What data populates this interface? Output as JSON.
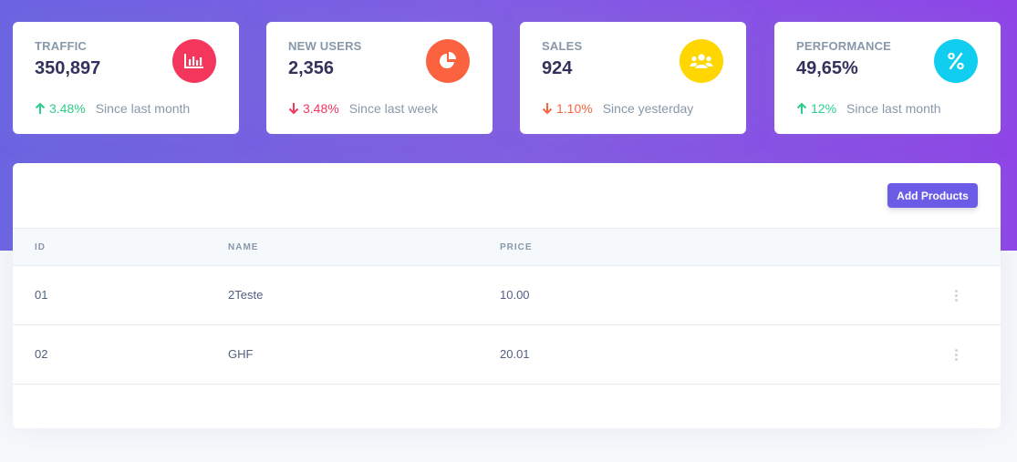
{
  "stats": [
    {
      "title": "TRAFFIC",
      "value": "350,897",
      "icon": "bar-chart-icon",
      "icon_color": "#f5365c",
      "change": "3.48%",
      "direction": "up",
      "change_color": "#2dce89",
      "since": "Since last month"
    },
    {
      "title": "NEW USERS",
      "value": "2,356",
      "icon": "pie-chart-icon",
      "icon_color": "#fb6340",
      "change": "3.48%",
      "direction": "down",
      "change_color": "#f5365c",
      "since": "Since last week"
    },
    {
      "title": "SALES",
      "value": "924",
      "icon": "users-icon",
      "icon_color": "#ffd600",
      "change": "1.10%",
      "direction": "down",
      "change_color": "#fb6340",
      "since": "Since yesterday"
    },
    {
      "title": "PERFORMANCE",
      "value": "49,65%",
      "icon": "percent-icon",
      "icon_color": "#11cdef",
      "change": "12%",
      "direction": "up",
      "change_color": "#2dce89",
      "since": "Since last month"
    }
  ],
  "products": {
    "add_button_label": "Add Products",
    "columns": [
      "ID",
      "NAME",
      "PRICE"
    ],
    "rows": [
      {
        "id": "01",
        "name": "2Teste",
        "price": "10.00"
      },
      {
        "id": "02",
        "name": "GHF",
        "price": "20.01"
      }
    ]
  },
  "colors": {
    "hero_gradient_start": "#6b63e3",
    "hero_gradient_end": "#8f44e8",
    "accent_button": "#6b5ce7"
  }
}
